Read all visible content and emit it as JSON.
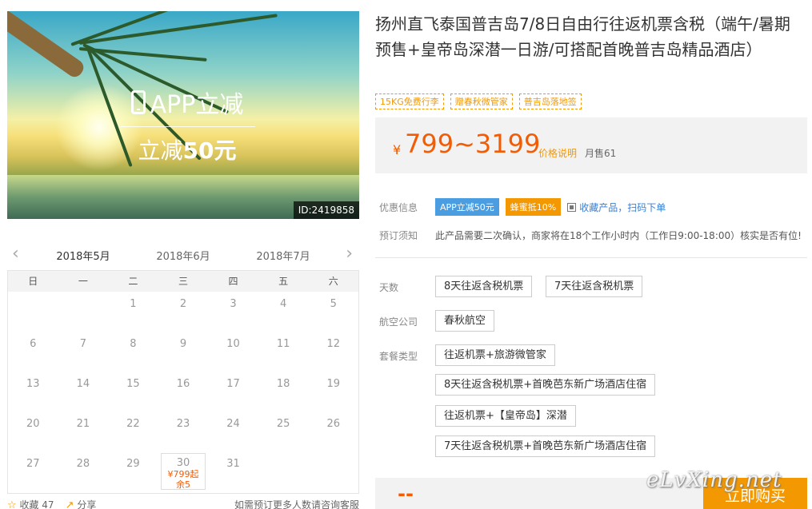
{
  "hero": {
    "promo_title": "APP立减",
    "promo_prefix": "立减",
    "promo_amount": "50元",
    "id_badge": "ID:2419858"
  },
  "calendar": {
    "prev_arrow": "‹",
    "next_arrow": "›",
    "months": [
      "2018年5月",
      "2018年6月",
      "2018年7月"
    ],
    "weekdays": [
      "日",
      "一",
      "二",
      "三",
      "四",
      "五",
      "六"
    ],
    "leading_blanks": 2,
    "days_in_month": 31,
    "available": {
      "day": "30",
      "price": "¥799起",
      "stock": "余5"
    }
  },
  "footer_left": {
    "favorite_label": "收藏 47",
    "share_label": "分享",
    "note": "如需预订更多人数请咨询客服"
  },
  "product": {
    "title": "扬州直飞泰国普吉岛7/8日自由行往返机票含税（端午/暑期预售+皇帝岛深潜一日游/可搭配首晚普吉岛精品酒店）",
    "tags": [
      "15KG免费行李",
      "赠春秋微管家",
      "普吉岛落地签"
    ],
    "price_currency": "¥",
    "price_range": "799~3199",
    "price_explain": "价格说明",
    "monthly_sales": "月售61"
  },
  "discount": {
    "label": "优惠信息",
    "app_badge": "APP立减50元",
    "honey_badge": "蜂蜜抵10%",
    "favorite_link": "收藏产品，扫码下单"
  },
  "booking_notice": {
    "label": "预订须知",
    "text": "此产品需要二次确认，商家将在18个工作小时内（工作日9:00-18:00）核实是否有位!"
  },
  "options": {
    "days_label": "天数",
    "days": [
      "8天往返含税机票",
      "7天往返含税机票"
    ],
    "airline_label": "航空公司",
    "airline": [
      "春秋航空"
    ],
    "package_label": "套餐类型",
    "packages": [
      "往返机票+旅游微管家",
      "8天往返含税机票+首晚芭东新广场酒店住宿",
      "往返机票+【皇帝岛】深潜",
      "7天往返含税机票+首晚芭东新广场酒店住宿"
    ]
  },
  "buy": {
    "total": "--",
    "button": "立即购买",
    "watermark": "eLvXing.net"
  },
  "colors": {
    "accent": "#f39800",
    "price": "#f25c05",
    "blue": "#4a9de0"
  }
}
